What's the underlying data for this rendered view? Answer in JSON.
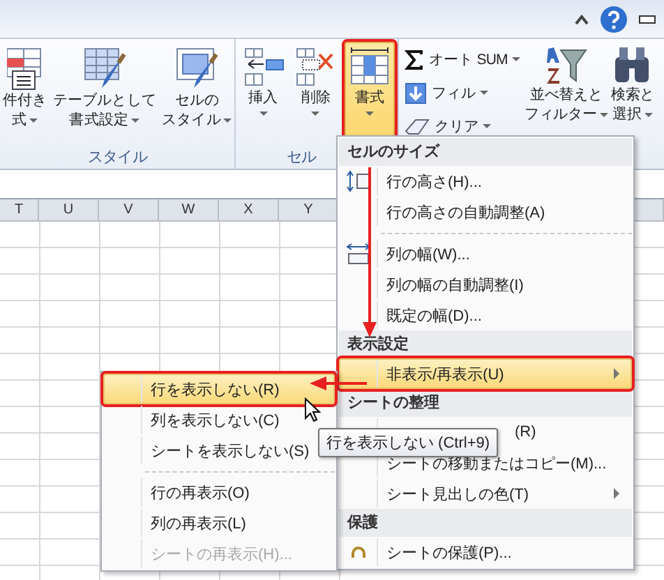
{
  "ribbon": {
    "groups": [
      {
        "label": "スタイル",
        "buttons": [
          {
            "lines": [
              "件付き",
              "式"
            ],
            "dropdown": true,
            "selected": false,
            "outlined": false
          },
          {
            "lines": [
              "テーブルとして",
              "書式設定"
            ],
            "dropdown": true,
            "selected": false,
            "outlined": false
          },
          {
            "lines": [
              "セルの",
              "スタイル"
            ],
            "dropdown": true,
            "selected": false,
            "outlined": false
          }
        ]
      },
      {
        "label": "セル",
        "buttons": [
          {
            "lines": [
              "挿入"
            ],
            "dropdown": true,
            "selected": false,
            "outlined": false
          },
          {
            "lines": [
              "削除"
            ],
            "dropdown": true,
            "selected": false,
            "outlined": false
          },
          {
            "lines": [
              "書式"
            ],
            "dropdown": true,
            "selected": true,
            "outlined": true
          }
        ]
      }
    ],
    "edit_small": [
      {
        "label": "オート SUM",
        "dropdown": true
      },
      {
        "label": "フィル",
        "dropdown": true
      },
      {
        "label": "クリア",
        "dropdown": true
      }
    ],
    "edit_large": [
      {
        "lines": [
          "並べ替えと",
          "フィルター"
        ],
        "dropdown": true
      },
      {
        "lines": [
          "検索と",
          "選択"
        ],
        "dropdown": true
      }
    ]
  },
  "sheet": {
    "columns": [
      "T",
      "U",
      "V",
      "W",
      "X",
      "Y"
    ]
  },
  "format_menu": {
    "entries": [
      {
        "kind": "header",
        "label": "セルのサイズ"
      },
      {
        "kind": "item",
        "label": "行の高さ(H)...",
        "selected": false,
        "outlined": false,
        "submenu": false
      },
      {
        "kind": "item",
        "label": "行の高さの自動調整(A)",
        "selected": false,
        "outlined": false,
        "submenu": false
      },
      {
        "kind": "separator"
      },
      {
        "kind": "item",
        "label": "列の幅(W)...",
        "selected": false,
        "outlined": false,
        "submenu": false
      },
      {
        "kind": "item",
        "label": "列の幅の自動調整(I)",
        "selected": false,
        "outlined": false,
        "submenu": false
      },
      {
        "kind": "item",
        "label": "既定の幅(D)...",
        "selected": false,
        "outlined": false,
        "submenu": false
      },
      {
        "kind": "header",
        "label": "表示設定"
      },
      {
        "kind": "item",
        "label": "非表示/再表示(U)",
        "selected": true,
        "outlined": true,
        "submenu": true
      },
      {
        "kind": "header",
        "label": "シートの整理"
      },
      {
        "kind": "item",
        "label": "(R)",
        "selected": false,
        "outlined": false,
        "submenu": false,
        "covered": true
      },
      {
        "kind": "item",
        "label": "シートの移動またはコピー(M)...",
        "selected": false,
        "outlined": false,
        "submenu": false
      },
      {
        "kind": "item",
        "label": "シート見出しの色(T)",
        "selected": false,
        "outlined": false,
        "submenu": true
      },
      {
        "kind": "header",
        "label": "保護"
      },
      {
        "kind": "item",
        "label": "シートの保護(P)...",
        "selected": false,
        "outlined": false,
        "submenu": false
      }
    ]
  },
  "hide_submenu": {
    "entries": [
      {
        "kind": "item",
        "label": "行を表示しない(R)",
        "selected": true,
        "outlined": true,
        "disabled": false
      },
      {
        "kind": "item",
        "label": "列を表示しない(C)",
        "selected": false,
        "outlined": false,
        "disabled": false
      },
      {
        "kind": "item",
        "label": "シートを表示しない(S)",
        "selected": false,
        "outlined": false,
        "disabled": false
      },
      {
        "kind": "separator"
      },
      {
        "kind": "item",
        "label": "行の再表示(O)",
        "selected": false,
        "outlined": false,
        "disabled": false
      },
      {
        "kind": "item",
        "label": "列の再表示(L)",
        "selected": false,
        "outlined": false,
        "disabled": false
      },
      {
        "kind": "item",
        "label": "シートの再表示(H)...",
        "selected": false,
        "outlined": false,
        "disabled": true
      }
    ]
  },
  "tooltip": {
    "text": "行を表示しない (Ctrl+9)"
  }
}
